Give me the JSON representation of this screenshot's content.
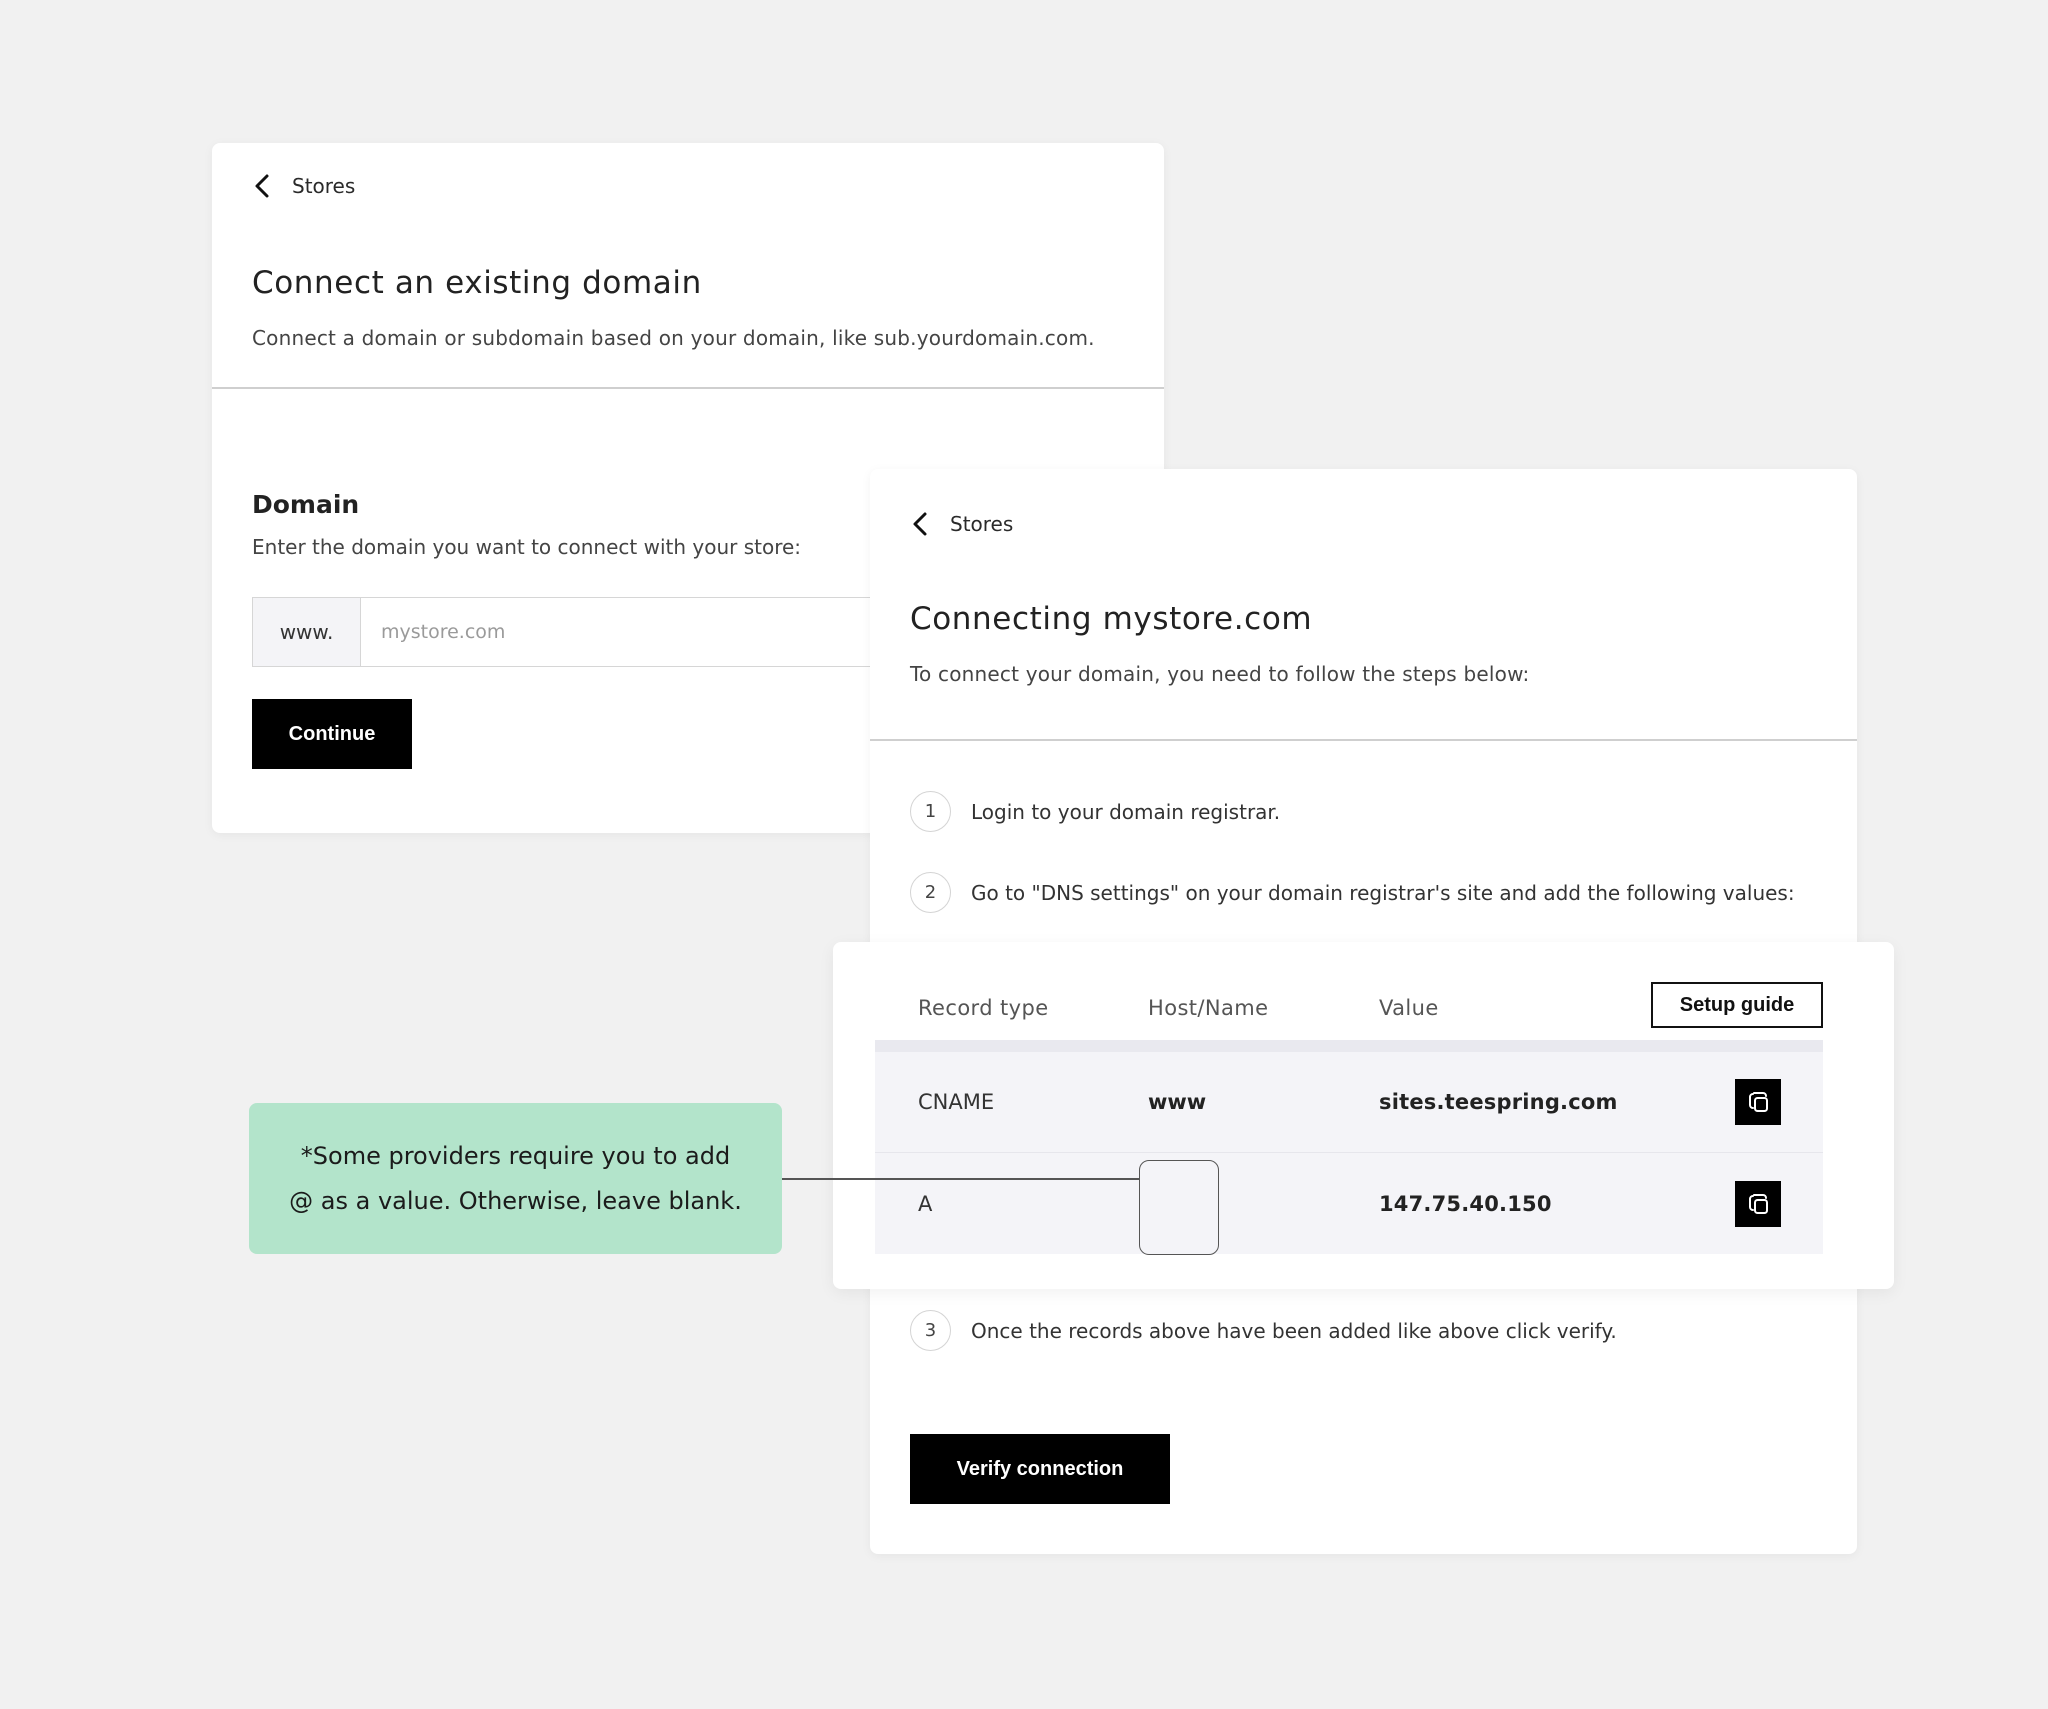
{
  "connect_card": {
    "back_label": "Stores",
    "title": "Connect an existing domain",
    "subtitle": "Connect a domain or subdomain based on your domain, like sub.yourdomain.com.",
    "domain_label": "Domain",
    "domain_hint": "Enter the domain you want to connect with your store:",
    "domain_prefix": "www.",
    "domain_placeholder": "mystore.com",
    "continue_label": "Continue"
  },
  "connecting_card": {
    "back_label": "Stores",
    "title": "Connecting mystore.com",
    "subtitle": "To connect your domain, you need to follow the steps below:",
    "steps": [
      {
        "num": "1",
        "text": "Login to your domain registrar."
      },
      {
        "num": "2",
        "text": "Go to \"DNS settings\" on your domain registrar's site and add the following values:"
      },
      {
        "num": "3",
        "text": "Once the records above have been added like above click verify."
      }
    ],
    "verify_label": "Verify connection"
  },
  "dns_table": {
    "headers": {
      "type": "Record type",
      "host": "Host/Name",
      "value": "Value"
    },
    "setup_guide_label": "Setup guide",
    "rows": [
      {
        "type": "CNAME",
        "host": "www",
        "value": "sites.teespring.com"
      },
      {
        "type": "A",
        "host": "",
        "value": "147.75.40.150"
      }
    ]
  },
  "callout": {
    "line1": "*Some providers require you to add",
    "line2": "@ as a value. Otherwise, leave blank."
  },
  "icons": {
    "back": "chevron-left-icon",
    "copy": "copy-icon"
  },
  "colors": {
    "background": "#f1f1f1",
    "primary_button": "#000000",
    "callout": "#b3e4cb"
  }
}
